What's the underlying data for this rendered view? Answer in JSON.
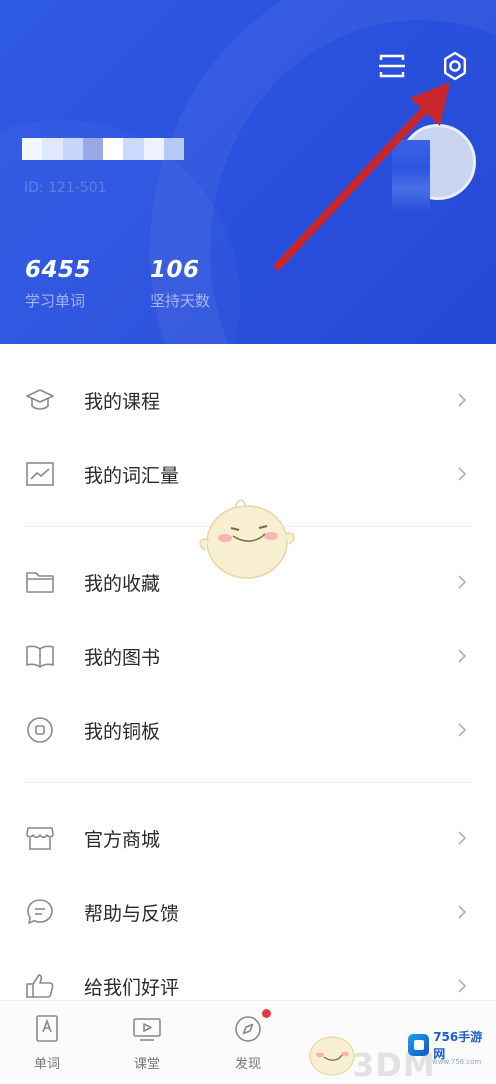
{
  "header": {
    "user_id_masked": "ID: 121-501",
    "stats": [
      {
        "value": "6455",
        "label": "学习单词"
      },
      {
        "value": "106",
        "label": "坚持天数"
      }
    ]
  },
  "menu": {
    "group1": [
      {
        "label": "我的课程",
        "icon": "graduation-cap-icon"
      },
      {
        "label": "我的词汇量",
        "icon": "chart-icon"
      }
    ],
    "group2": [
      {
        "label": "我的收藏",
        "icon": "folder-icon"
      },
      {
        "label": "我的图书",
        "icon": "book-icon"
      },
      {
        "label": "我的铜板",
        "icon": "coin-icon"
      }
    ],
    "group3": [
      {
        "label": "官方商城",
        "icon": "store-icon"
      },
      {
        "label": "帮助与反馈",
        "icon": "chat-icon"
      },
      {
        "label": "给我们好评",
        "icon": "thumbs-up-icon"
      }
    ]
  },
  "bottom_nav": [
    {
      "label": "单词",
      "icon": "word-book-icon"
    },
    {
      "label": "课堂",
      "icon": "video-icon"
    },
    {
      "label": "发现",
      "icon": "compass-icon",
      "has_badge": true
    }
  ],
  "watermarks": {
    "brand_a": "3DM",
    "brand_b": "756手游网",
    "brand_b_url": "www.756.com"
  },
  "colors": {
    "header_blue": "#2a52de",
    "arrow_red": "#c8262b",
    "badge_red": "#e53b3b",
    "text_primary": "#2b2b2b",
    "text_secondary": "#777777"
  }
}
